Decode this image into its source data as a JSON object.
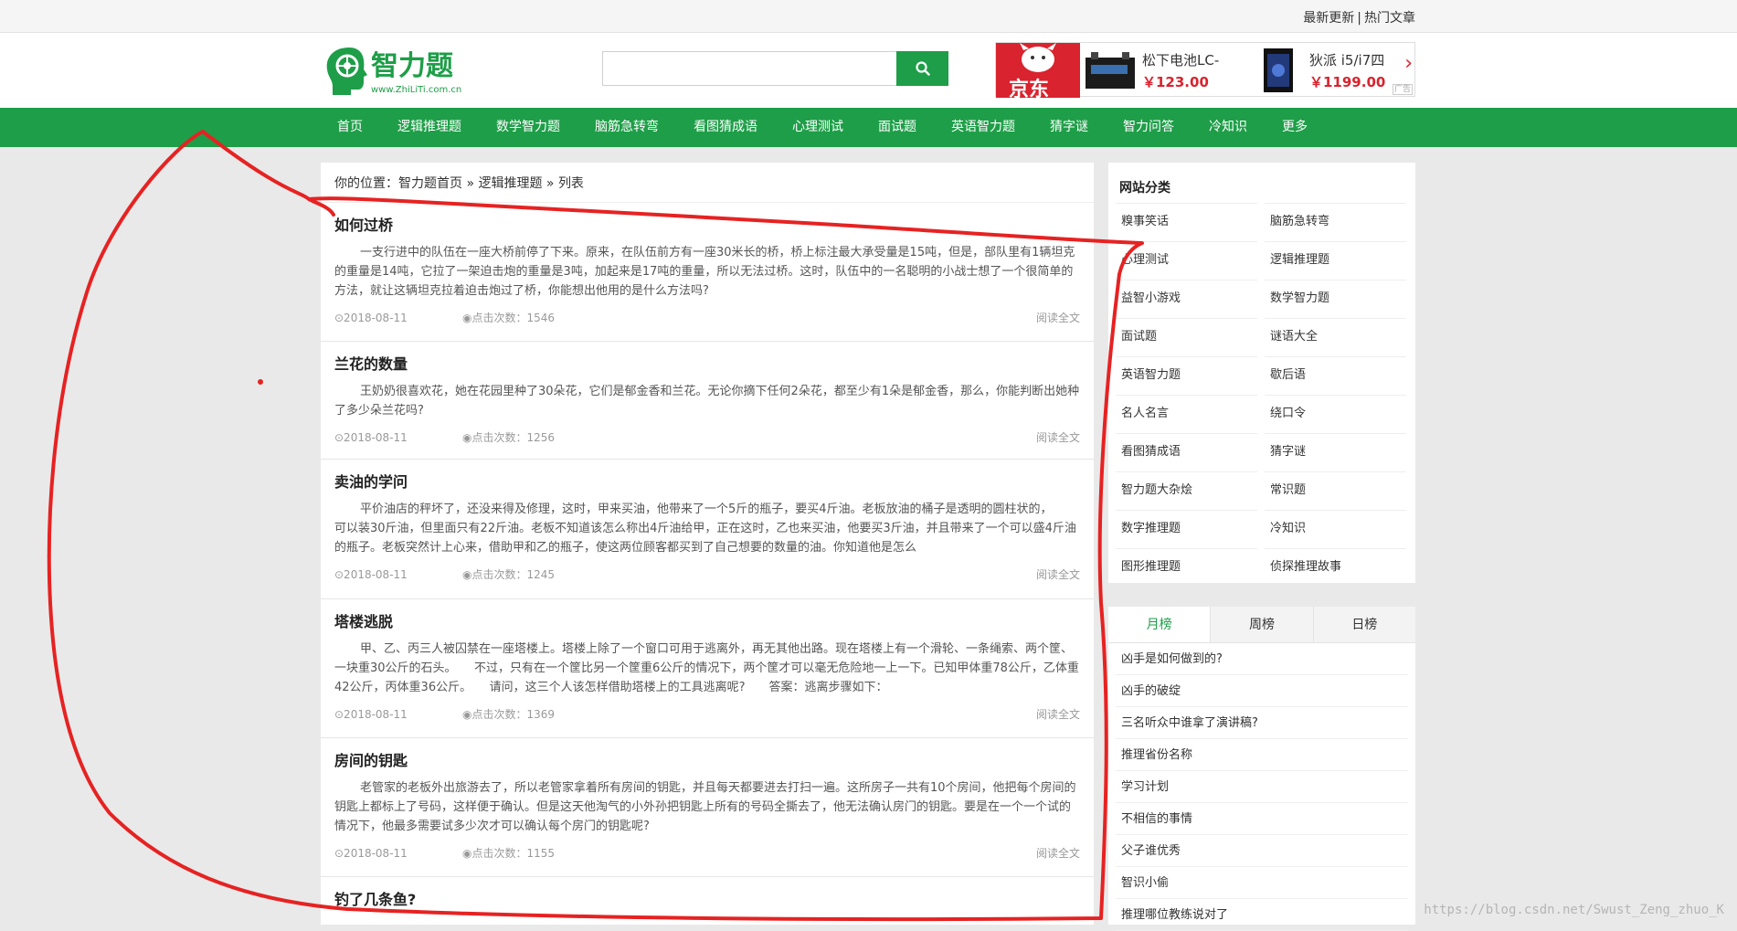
{
  "topbar": {
    "latest": "最新更新",
    "separator": "|",
    "hot": "热门文章"
  },
  "logo": {
    "cn": "智力题",
    "url": "www.ZhiLiTi.com.cn"
  },
  "search": {
    "placeholder": ""
  },
  "ad": {
    "brand": "京东",
    "item1_title": "松下电池LC-",
    "item1_price": "￥123.00",
    "item2_title": "狄派 i5/i7四",
    "item2_price": "￥1199.00",
    "next_glyph": "›",
    "ad_tag": "广告"
  },
  "nav": [
    "首页",
    "逻辑推理题",
    "数学智力题",
    "脑筋急转弯",
    "看图猜成语",
    "心理测试",
    "面试题",
    "英语智力题",
    "猜字谜",
    "智力问答",
    "冷知识",
    "更多"
  ],
  "breadcrumb": {
    "prefix": "你的位置：",
    "home": "智力题首页",
    "sep1": " » ",
    "category": "逻辑推理题",
    "sep2": " » ",
    "current": "列表"
  },
  "articles": [
    {
      "title": "如何过桥",
      "desc": "一支行进中的队伍在一座大桥前停了下来。原来，在队伍前方有一座30米长的桥，桥上标注最大承受量是15吨，但是，部队里有1辆坦克的重量是14吨，它拉了一架迫击炮的重量是3吨，加起来是17吨的重量，所以无法过桥。这时，队伍中的一名聪明的小战士想了一个很简单的方法，就让这辆坦克拉着迫击炮过了桥，你能想出他用的是什么方法吗?",
      "date": "⊙2018-08-11",
      "views": "◉点击次数：1546",
      "more": "阅读全文"
    },
    {
      "title": "兰花的数量",
      "desc": "王奶奶很喜欢花，她在花园里种了30朵花，它们是郁金香和兰花。无论你摘下任何2朵花，都至少有1朵是郁金香，那么，你能判断出她种了多少朵兰花吗?",
      "date": "⊙2018-08-11",
      "views": "◉点击次数：1256",
      "more": "阅读全文"
    },
    {
      "title": "卖油的学问",
      "desc": "平价油店的秤坏了，还没来得及修理，这时，甲来买油，他带来了一个5斤的瓶子，要买4斤油。老板放油的桶子是透明的圆柱状的，　　可以装30斤油，但里面只有22斤油。老板不知道该怎么称出4斤油给甲，正在这时，乙也来买油，他要买3斤油，并且带来了一个可以盛4斤油的瓶子。老板突然计上心来，借助甲和乙的瓶子，使这两位顾客都买到了自己想要的数量的油。你知道他是怎么",
      "date": "⊙2018-08-11",
      "views": "◉点击次数：1245",
      "more": "阅读全文"
    },
    {
      "title": "塔楼逃脱",
      "desc": "甲、乙、丙三人被囚禁在一座塔楼上。塔楼上除了一个窗口可用于逃离外，再无其他出路。现在塔楼上有一个滑轮、一条绳索、两个筐、一块重30公斤的石头。　　不过，只有在一个筐比另一个筐重6公斤的情况下，两个筐才可以毫无危险地一上一下。已知甲体重78公斤，乙体重42公斤，丙体重36公斤。　　请问，这三个人该怎样借助塔楼上的工具逃离呢?　　答案：逃离步骤如下：",
      "date": "⊙2018-08-11",
      "views": "◉点击次数：1369",
      "more": "阅读全文"
    },
    {
      "title": "房间的钥匙",
      "desc": "老管家的老板外出旅游去了，所以老管家拿着所有房间的钥匙，并且每天都要进去打扫一遍。这所房子一共有10个房间，他把每个房间的钥匙上都标上了号码，这样便于确认。但是这天他淘气的小外孙把钥匙上所有的号码全撕去了，他无法确认房门的钥匙。要是在一个一个试的情况下，他最多需要试多少次才可以确认每个房门的钥匙呢?",
      "date": "⊙2018-08-11",
      "views": "◉点击次数：1155",
      "more": "阅读全文"
    },
    {
      "title": "钓了几条鱼?",
      "desc": "",
      "date": "",
      "views": "",
      "more": ""
    }
  ],
  "sidebar": {
    "title": "网站分类",
    "categories": [
      "糗事笑话",
      "脑筋急转弯",
      "心理测试",
      "逻辑推理题",
      "益智小游戏",
      "数学智力题",
      "面试题",
      "谜语大全",
      "英语智力题",
      "歇后语",
      "名人名言",
      "绕口令",
      "看图猜成语",
      "猜字谜",
      "智力题大杂烩",
      "常识题",
      "数字推理题",
      "冷知识",
      "图形推理题",
      "侦探推理故事"
    ]
  },
  "ranking": {
    "tabs": [
      "月榜",
      "周榜",
      "日榜"
    ],
    "items": [
      "凶手是如何做到的?",
      "凶手的破绽",
      "三名听众中谁拿了演讲稿?",
      "推理省份名称",
      "学习计划",
      "不相信的事情",
      "父子谁优秀",
      "智识小偷",
      "推理哪位教练说对了"
    ]
  },
  "watermark": "https://blog.csdn.net/Swust_Zeng_zhuo_K",
  "colors": {
    "green": "#1e9e48",
    "red_annotation": "#e62222",
    "jd_red": "#d9232e"
  }
}
